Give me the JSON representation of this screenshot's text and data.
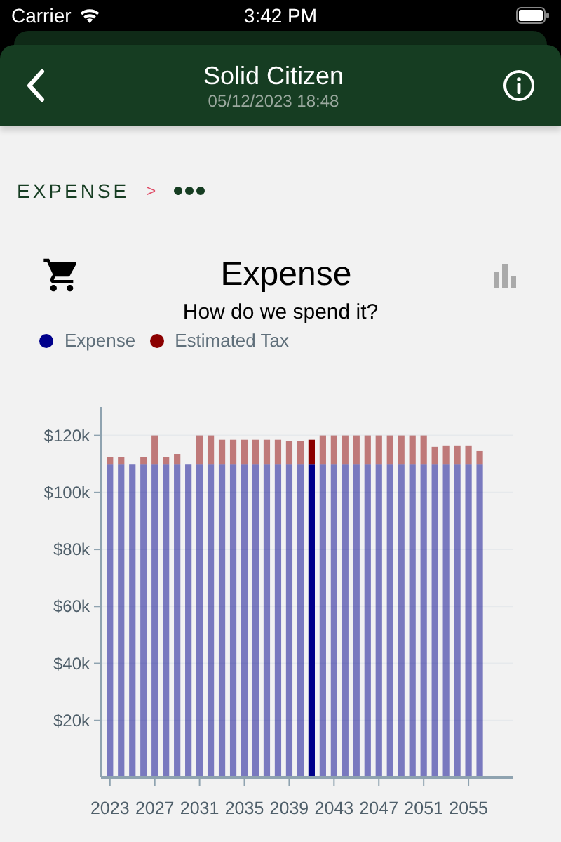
{
  "status_bar": {
    "carrier": "Carrier",
    "time": "3:42 PM"
  },
  "header": {
    "title": "Solid Citizen",
    "subtitle": "05/12/2023 18:48"
  },
  "breadcrumb": {
    "items": [
      "EXPENSE"
    ],
    "separator": ">"
  },
  "card": {
    "title": "Expense",
    "subtitle": "How do we spend it?",
    "chart_data": {
      "type": "bar",
      "stacked": true,
      "orientation": "vertical",
      "grid": true,
      "x": [
        2023,
        2024,
        2025,
        2026,
        2027,
        2028,
        2029,
        2030,
        2031,
        2032,
        2033,
        2034,
        2035,
        2036,
        2037,
        2038,
        2039,
        2040,
        2041,
        2042,
        2043,
        2044,
        2045,
        2046,
        2047,
        2048,
        2049,
        2050,
        2051,
        2052,
        2053,
        2054,
        2055,
        2056
      ],
      "series": [
        {
          "name": "Expense",
          "color": "#00008b",
          "values": [
            110000,
            110000,
            110000,
            110000,
            110000,
            110000,
            110000,
            110000,
            110000,
            110000,
            110000,
            110000,
            110000,
            110000,
            110000,
            110000,
            110000,
            110000,
            110000,
            110000,
            110000,
            110000,
            110000,
            110000,
            110000,
            110000,
            110000,
            110000,
            110000,
            110000,
            110000,
            110000,
            110000,
            110000
          ]
        },
        {
          "name": "Estimated Tax",
          "color": "#8b0000",
          "values": [
            2500,
            2500,
            0,
            2500,
            10000,
            2500,
            3500,
            0,
            10000,
            10000,
            8500,
            8500,
            8500,
            8500,
            8500,
            8500,
            8000,
            8000,
            8500,
            10000,
            10000,
            10000,
            10000,
            10000,
            10000,
            10000,
            10000,
            10000,
            10000,
            6000,
            6500,
            6500,
            6500,
            4500
          ]
        }
      ],
      "xlim": [
        2022.2,
        2059
      ],
      "ylim": [
        0,
        130000
      ],
      "yticks": [
        {
          "value": 20000,
          "label": "$20k"
        },
        {
          "value": 40000,
          "label": "$40k"
        },
        {
          "value": 60000,
          "label": "$60k"
        },
        {
          "value": 80000,
          "label": "$80k"
        },
        {
          "value": 100000,
          "label": "$100k"
        },
        {
          "value": 120000,
          "label": "$120k"
        }
      ],
      "xticks": [
        2023,
        2027,
        2031,
        2035,
        2039,
        2043,
        2047,
        2051,
        2055
      ]
    },
    "bars": [
      {
        "selected": false
      },
      {
        "selected": false
      },
      {
        "selected": false
      },
      {
        "selected": false
      },
      {
        "selected": false
      },
      {
        "selected": false
      },
      {
        "selected": false
      },
      {
        "selected": false
      },
      {
        "selected": false
      },
      {
        "selected": false
      },
      {
        "selected": false
      },
      {
        "selected": false
      },
      {
        "selected": false
      },
      {
        "selected": false
      },
      {
        "selected": false
      },
      {
        "selected": false
      },
      {
        "selected": false
      },
      {
        "selected": false
      },
      {
        "selected": true
      },
      {
        "selected": false
      },
      {
        "selected": false
      },
      {
        "selected": false
      },
      {
        "selected": false
      },
      {
        "selected": false
      },
      {
        "selected": false
      },
      {
        "selected": false
      },
      {
        "selected": false
      },
      {
        "selected": false
      },
      {
        "selected": false
      },
      {
        "selected": false
      },
      {
        "selected": false
      },
      {
        "selected": false
      },
      {
        "selected": false
      },
      {
        "selected": false
      }
    ]
  }
}
